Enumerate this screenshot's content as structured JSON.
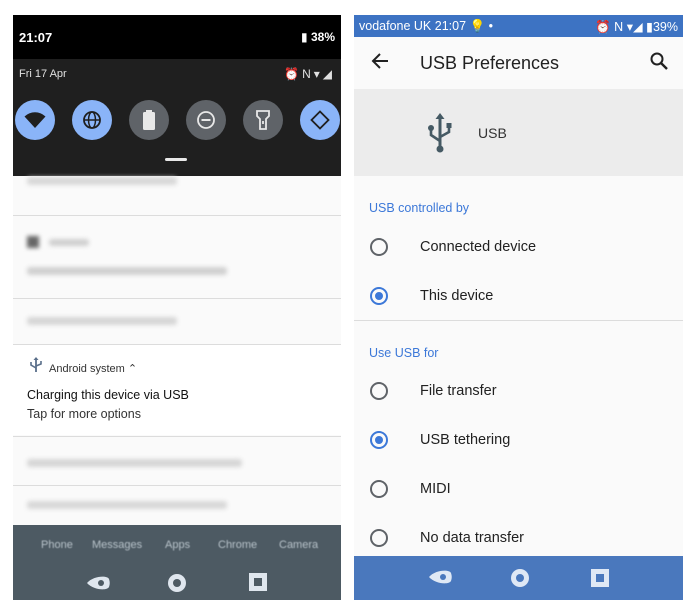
{
  "left": {
    "status": {
      "time": "21:07",
      "battery": "38%"
    },
    "shade": {
      "date": "Fri 17 Apr"
    },
    "usb_notification": {
      "app": "Android system",
      "title": "Charging this device via USB",
      "subtitle": "Tap for more options"
    },
    "dock": [
      "Phone",
      "Messages",
      "Apps",
      "Chrome",
      "Camera"
    ]
  },
  "right": {
    "status": {
      "carrier_time": "vodafone UK 21:07",
      "battery": "39%"
    },
    "appbar": {
      "title": "USB Preferences"
    },
    "header": {
      "label": "USB"
    },
    "controlled_by": {
      "heading": "USB controlled by",
      "options": [
        {
          "label": "Connected device",
          "selected": false
        },
        {
          "label": "This device",
          "selected": true
        }
      ]
    },
    "use_for": {
      "heading": "Use USB for",
      "options": [
        {
          "label": "File transfer",
          "selected": false
        },
        {
          "label": "USB tethering",
          "selected": true
        },
        {
          "label": "MIDI",
          "selected": false
        },
        {
          "label": "No data transfer",
          "selected": false
        }
      ]
    }
  },
  "colors": {
    "accent": "#3c78d8",
    "tile_on": "#8ab4f8",
    "tile_off": "#5f6368",
    "status_bar": "#3d73c3",
    "nav_bar": "#4a78bd"
  }
}
